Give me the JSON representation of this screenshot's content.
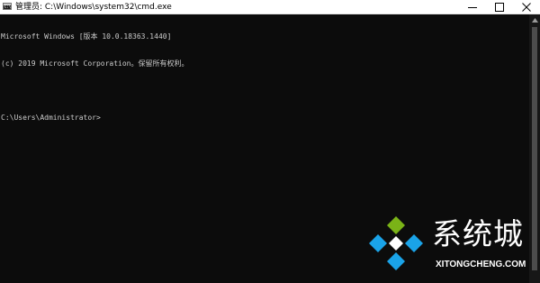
{
  "window": {
    "title": "管理员: C:\\Windows\\system32\\cmd.exe",
    "app_icon": "cmd-icon",
    "app_icon_prompt": "C:\\",
    "controls": [
      "minimize-icon",
      "maximize-icon",
      "close-icon"
    ]
  },
  "console": {
    "lines": [
      "Microsoft Windows [版本 10.0.18363.1440]",
      "(c) 2019 Microsoft Corporation。保留所有权利。",
      "",
      "C:\\Users\\Administrator>"
    ],
    "text_color": "#cccccc",
    "background": "#0c0c0c"
  },
  "watermark": {
    "brand": "系统城",
    "site": "XITONGCHENG.COM",
    "logo_colors": [
      "#7ab317",
      "#1aa3e8"
    ]
  }
}
